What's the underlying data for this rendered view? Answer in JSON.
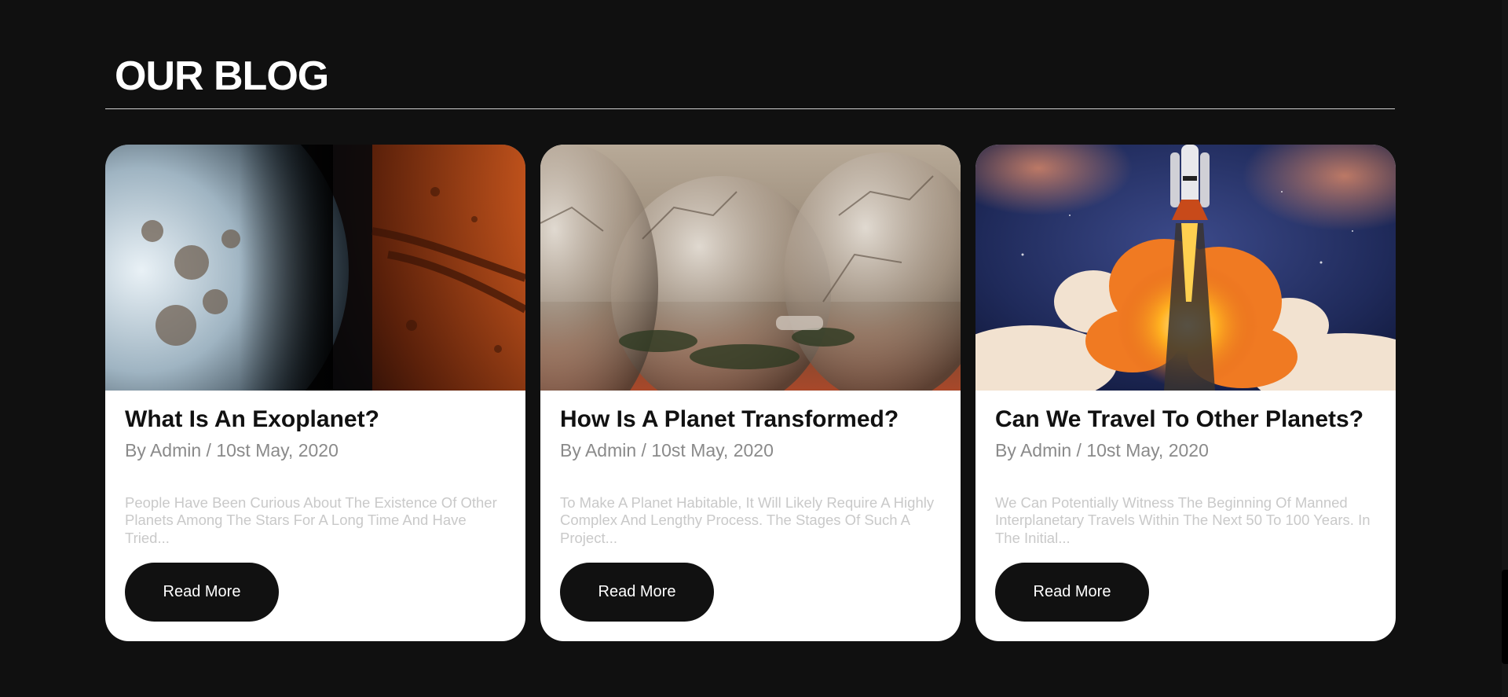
{
  "section": {
    "title": "OUR BLOG"
  },
  "posts": [
    {
      "title": "What Is An Exoplanet?",
      "meta": "By Admin / 10st May, 2020",
      "excerpt": "People Have Been Curious About The Existence Of Other Planets Among The Stars For A Long Time And Have Tried...",
      "button_label": "Read More",
      "image": "exoplanet-illustration"
    },
    {
      "title": "How Is A Planet Transformed?",
      "meta": "By Admin / 10st May, 2020",
      "excerpt": "To Make A Planet Habitable, It Will Likely Require A Highly Complex And Lengthy Process. The Stages Of Such A Project...",
      "button_label": "Read More",
      "image": "dome-colony-illustration"
    },
    {
      "title": "Can We Travel To Other Planets?",
      "meta": "By Admin / 10st May, 2020",
      "excerpt": "We Can Potentially Witness The Beginning Of Manned Interplanetary Travels Within The Next 50 To 100 Years. In The Initial...",
      "button_label": "Read More",
      "image": "rocket-launch-illustration"
    }
  ],
  "colors": {
    "background": "#101010",
    "card": "#ffffff",
    "button": "#111111",
    "meta_text": "#8a8a8a",
    "excerpt_text": "#c9c9c9"
  }
}
